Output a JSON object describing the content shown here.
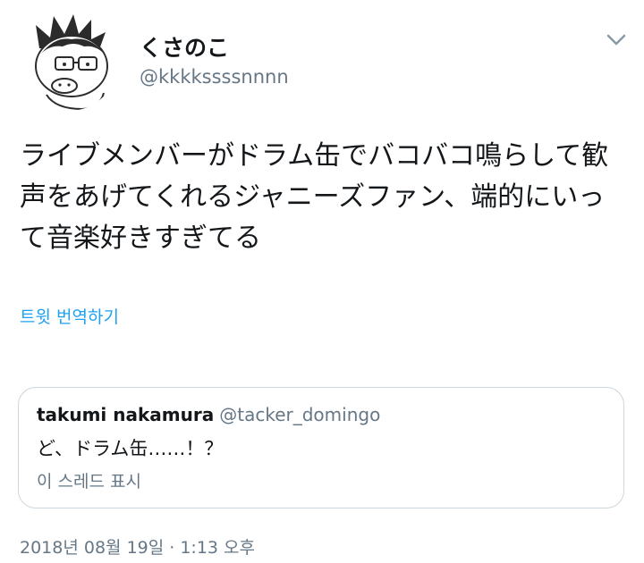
{
  "author": {
    "display_name": "くさのこ",
    "handle": "@kkkkssssnnnn",
    "avatar_icon": "cartoon-character-with-glasses-avatar"
  },
  "menu": {
    "icon": "chevron-down-icon"
  },
  "tweet": {
    "text": "ライブメンバーがドラム缶でバコバコ鳴らして歓声をあげてくれるジャニーズファン、端的にいって音楽好きすぎてる",
    "translate_label": "트윗 번역하기",
    "timestamp": "2018년 08월 19일 · 1:13 오후"
  },
  "quoted_tweet": {
    "display_name": "takumi nakamura",
    "handle": "@tacker_domingo",
    "text": "ど、ドラム缶……！？",
    "show_thread_label": "이 스레드 표시"
  },
  "colors": {
    "link": "#1da1f2",
    "secondary_text": "#657786",
    "primary_text": "#14171a",
    "border": "#ccd6dd"
  }
}
